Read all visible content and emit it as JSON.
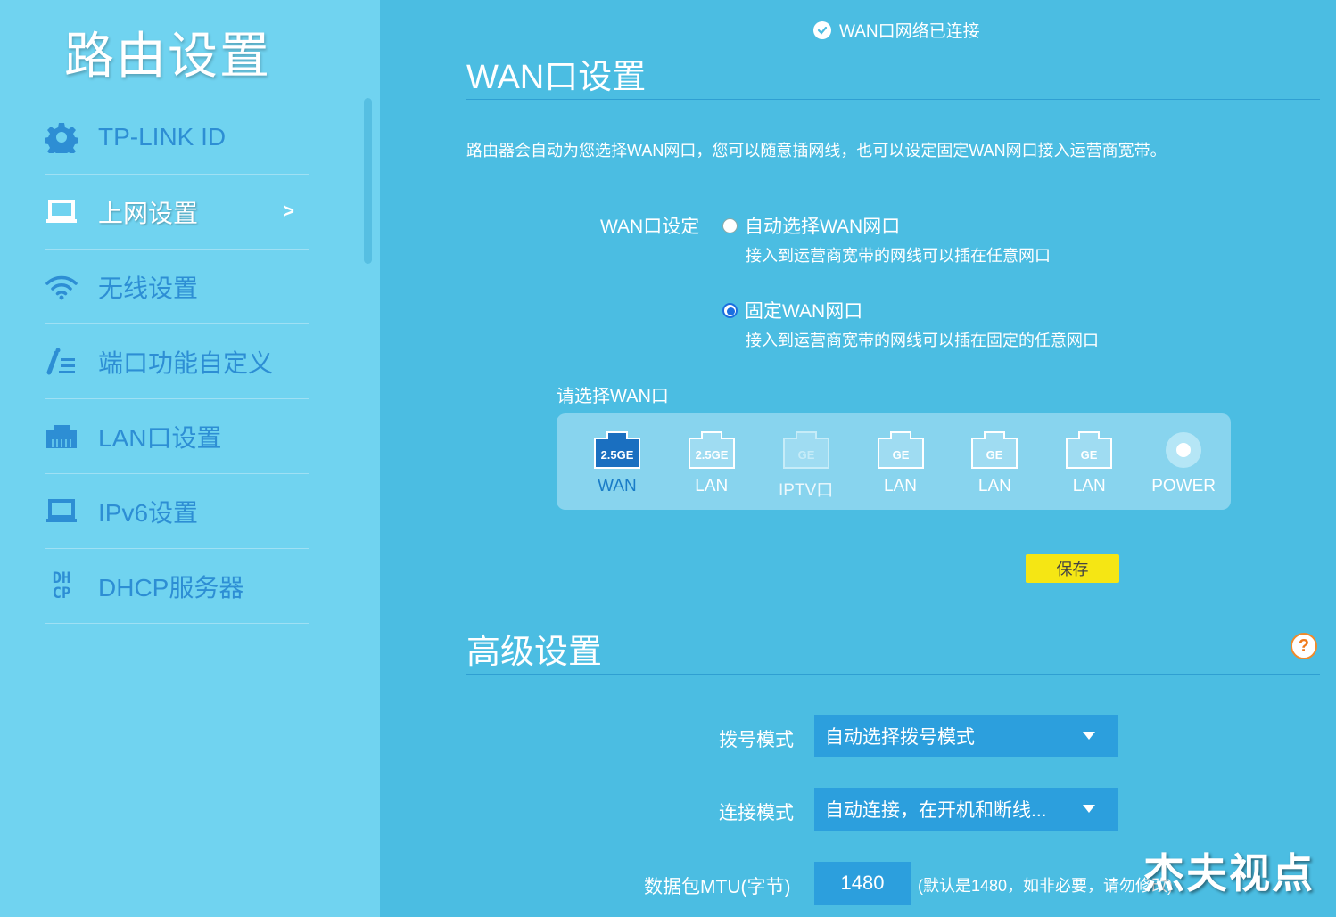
{
  "sidebar": {
    "title": "路由设置",
    "items": [
      {
        "label": "TP-LINK ID",
        "icon": "gear-icon"
      },
      {
        "label": "上网设置",
        "icon": "laptop-icon",
        "active": true,
        "chevron": ">"
      },
      {
        "label": "无线设置",
        "icon": "wifi-icon"
      },
      {
        "label": "端口功能自定义",
        "icon": "port-custom-icon"
      },
      {
        "label": "LAN口设置",
        "icon": "ethernet-port-icon"
      },
      {
        "label": "IPv6设置",
        "icon": "laptop-icon"
      },
      {
        "label": "DHCP服务器",
        "icon": "dhcp-icon",
        "icon_text": "DH\nCP"
      }
    ]
  },
  "status": {
    "text": "WAN口网络已连接"
  },
  "wan": {
    "title": "WAN口设置",
    "description": "路由器会自动为您选择WAN网口，您可以随意插网线，也可以设定固定WAN网口接入运营商宽带。",
    "setting_label": "WAN口设定",
    "options": [
      {
        "label": "自动选择WAN网口",
        "sub": "接入到运营商宽带的网线可以插在任意网口",
        "selected": false
      },
      {
        "label": "固定WAN网口",
        "sub": "接入到运营商宽带的网线可以插在固定的任意网口",
        "selected": true
      }
    ],
    "select_label": "请选择WAN口",
    "ports": [
      {
        "badge": "2.5GE",
        "label": "WAN",
        "state": "selected"
      },
      {
        "badge": "2.5GE",
        "label": "LAN",
        "state": "normal"
      },
      {
        "badge": "GE",
        "label": "IPTV口",
        "state": "disabled"
      },
      {
        "badge": "GE",
        "label": "LAN",
        "state": "normal"
      },
      {
        "badge": "GE",
        "label": "LAN",
        "state": "normal"
      },
      {
        "badge": "GE",
        "label": "LAN",
        "state": "normal"
      },
      {
        "badge": "",
        "label": "POWER",
        "state": "power"
      }
    ],
    "save_label": "保存"
  },
  "advanced": {
    "title": "高级设置",
    "help": "?",
    "dial_label": "拨号模式",
    "dial_value": "自动选择拨号模式",
    "conn_label": "连接模式",
    "conn_value": "自动连接，在开机和断线...",
    "mtu_label": "数据包MTU(字节)",
    "mtu_value": "1480",
    "mtu_hint": "(默认是1480，如非必要，请勿修改)"
  },
  "watermark": "杰夫视点",
  "colors": {
    "sidebar": "#70d3f0",
    "main": "#4bbde2",
    "accent": "#2d8ed4",
    "save": "#f5e614"
  }
}
